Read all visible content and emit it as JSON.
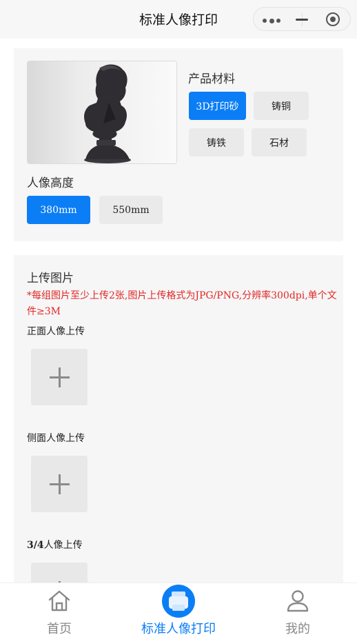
{
  "header": {
    "title": "标准人像打印"
  },
  "product": {
    "material_title": "产品材料",
    "materials": [
      "3D打印砂",
      "铸铜",
      "铸铁",
      "石材"
    ],
    "selected_material": "3D打印砂",
    "height_title": "人像高度",
    "heights": [
      "380mm",
      "550mm"
    ],
    "selected_height": "380mm"
  },
  "upload": {
    "title": "上传图片",
    "note": "*每组图片至少上传2张,图片上传格式为JPG/PNG,分辨率300dpi,单个文件≥3M",
    "front_label": "正面人像上传",
    "side_label": "侧面人像上传",
    "three_quarter_bold": "3/4",
    "three_quarter_rest": "人像上传"
  },
  "tabbar": {
    "items": [
      {
        "label": "首页",
        "icon": "home-icon"
      },
      {
        "label": "标准人像打印",
        "icon": "printer-icon"
      },
      {
        "label": "我的",
        "icon": "user-icon"
      }
    ],
    "active_index": 1
  },
  "colors": {
    "accent": "#0b7ef6",
    "warning": "#e32626",
    "card_bg": "#f6f6f6"
  }
}
